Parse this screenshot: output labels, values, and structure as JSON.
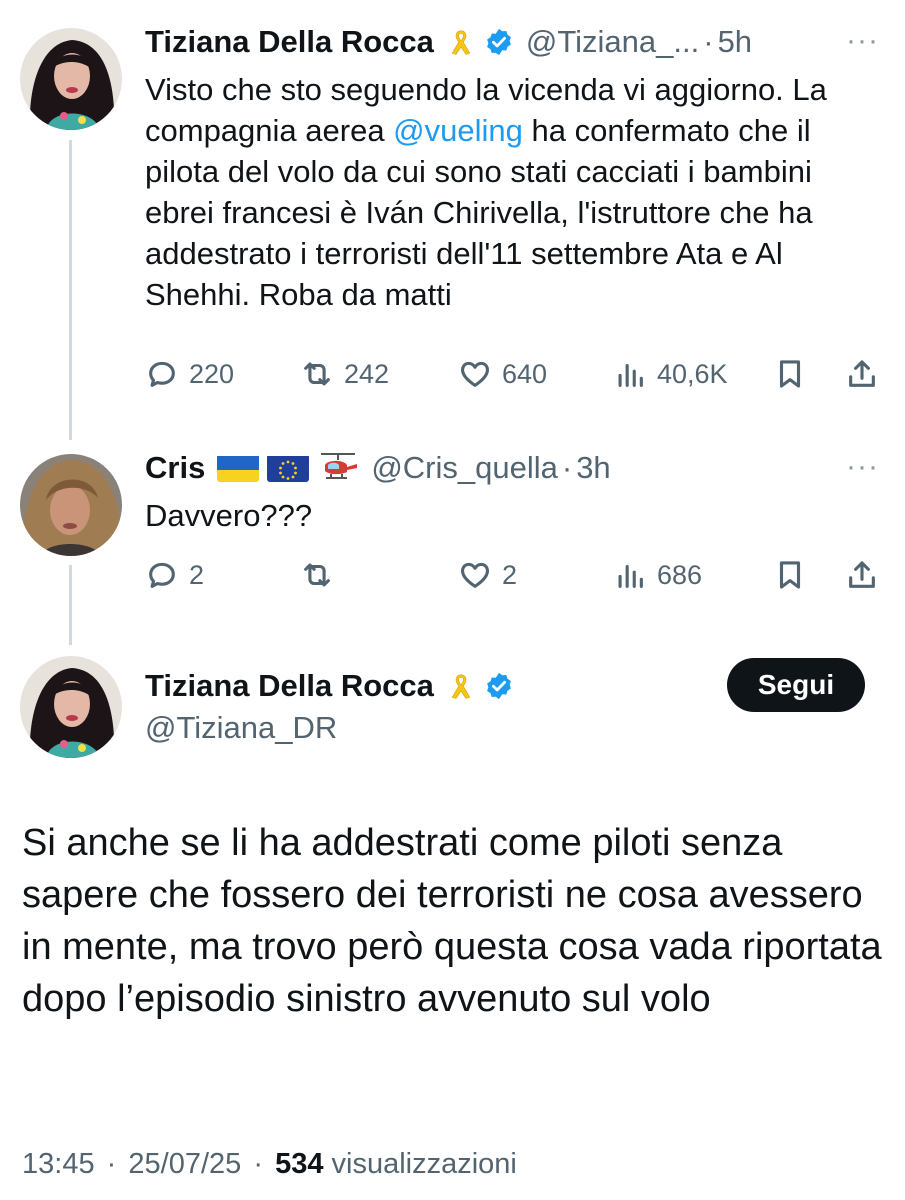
{
  "tweets": [
    {
      "author_name": "Tiziana Della Rocca",
      "handle": "@Tiziana_...",
      "separator": "·",
      "time": "5h",
      "text_before_mention": "Visto che sto seguendo la vicenda vi aggiorno. La compagnia aerea ",
      "mention": "@vueling",
      "text_after_mention": " ha confermato che il pilota del volo da cui sono stati cacciati i bambini ebrei francesi è Iván Chirivella, l'istruttore che ha addestrato i terroristi dell'11 settembre Ata e Al Shehhi. Roba da matti",
      "replies": "220",
      "retweets": "242",
      "likes": "640",
      "views": "40,6K",
      "more_label": "···"
    },
    {
      "author_name": "Cris",
      "handle": "@Cris_quella",
      "separator": "·",
      "time": "3h",
      "text": "Davvero???",
      "replies": "2",
      "retweets": "",
      "likes": "2",
      "views": "686",
      "more_label": "···",
      "decorations": [
        "ukraine-flag",
        "eu-flag",
        "helicopter"
      ]
    }
  ],
  "main_tweet": {
    "author_name": "Tiziana Della Rocca",
    "handle": "@Tiziana_DR",
    "follow_label": "Segui",
    "text": "Si anche se li ha addestrati come piloti senza sapere che fossero dei terroristi  ne  cosa avessero in mente, ma trovo però questa cosa vada riportata dopo l’episodio sinistro avvenuto sul volo",
    "time": "13:45",
    "separator1": "·",
    "date": "25/07/25",
    "separator2": "·",
    "views_count": "534",
    "views_label": "visualizzazioni"
  },
  "colors": {
    "text": "#0f1419",
    "secondary": "#536471",
    "accent": "#1d9bf0",
    "thread_line": "#cfd9de",
    "ribbon": "#f5c518"
  },
  "icons": [
    "reply-icon",
    "retweet-icon",
    "like-icon",
    "views-icon",
    "bookmark-icon",
    "share-icon",
    "verified-badge-icon",
    "yellow-ribbon-icon",
    "more-icon"
  ]
}
